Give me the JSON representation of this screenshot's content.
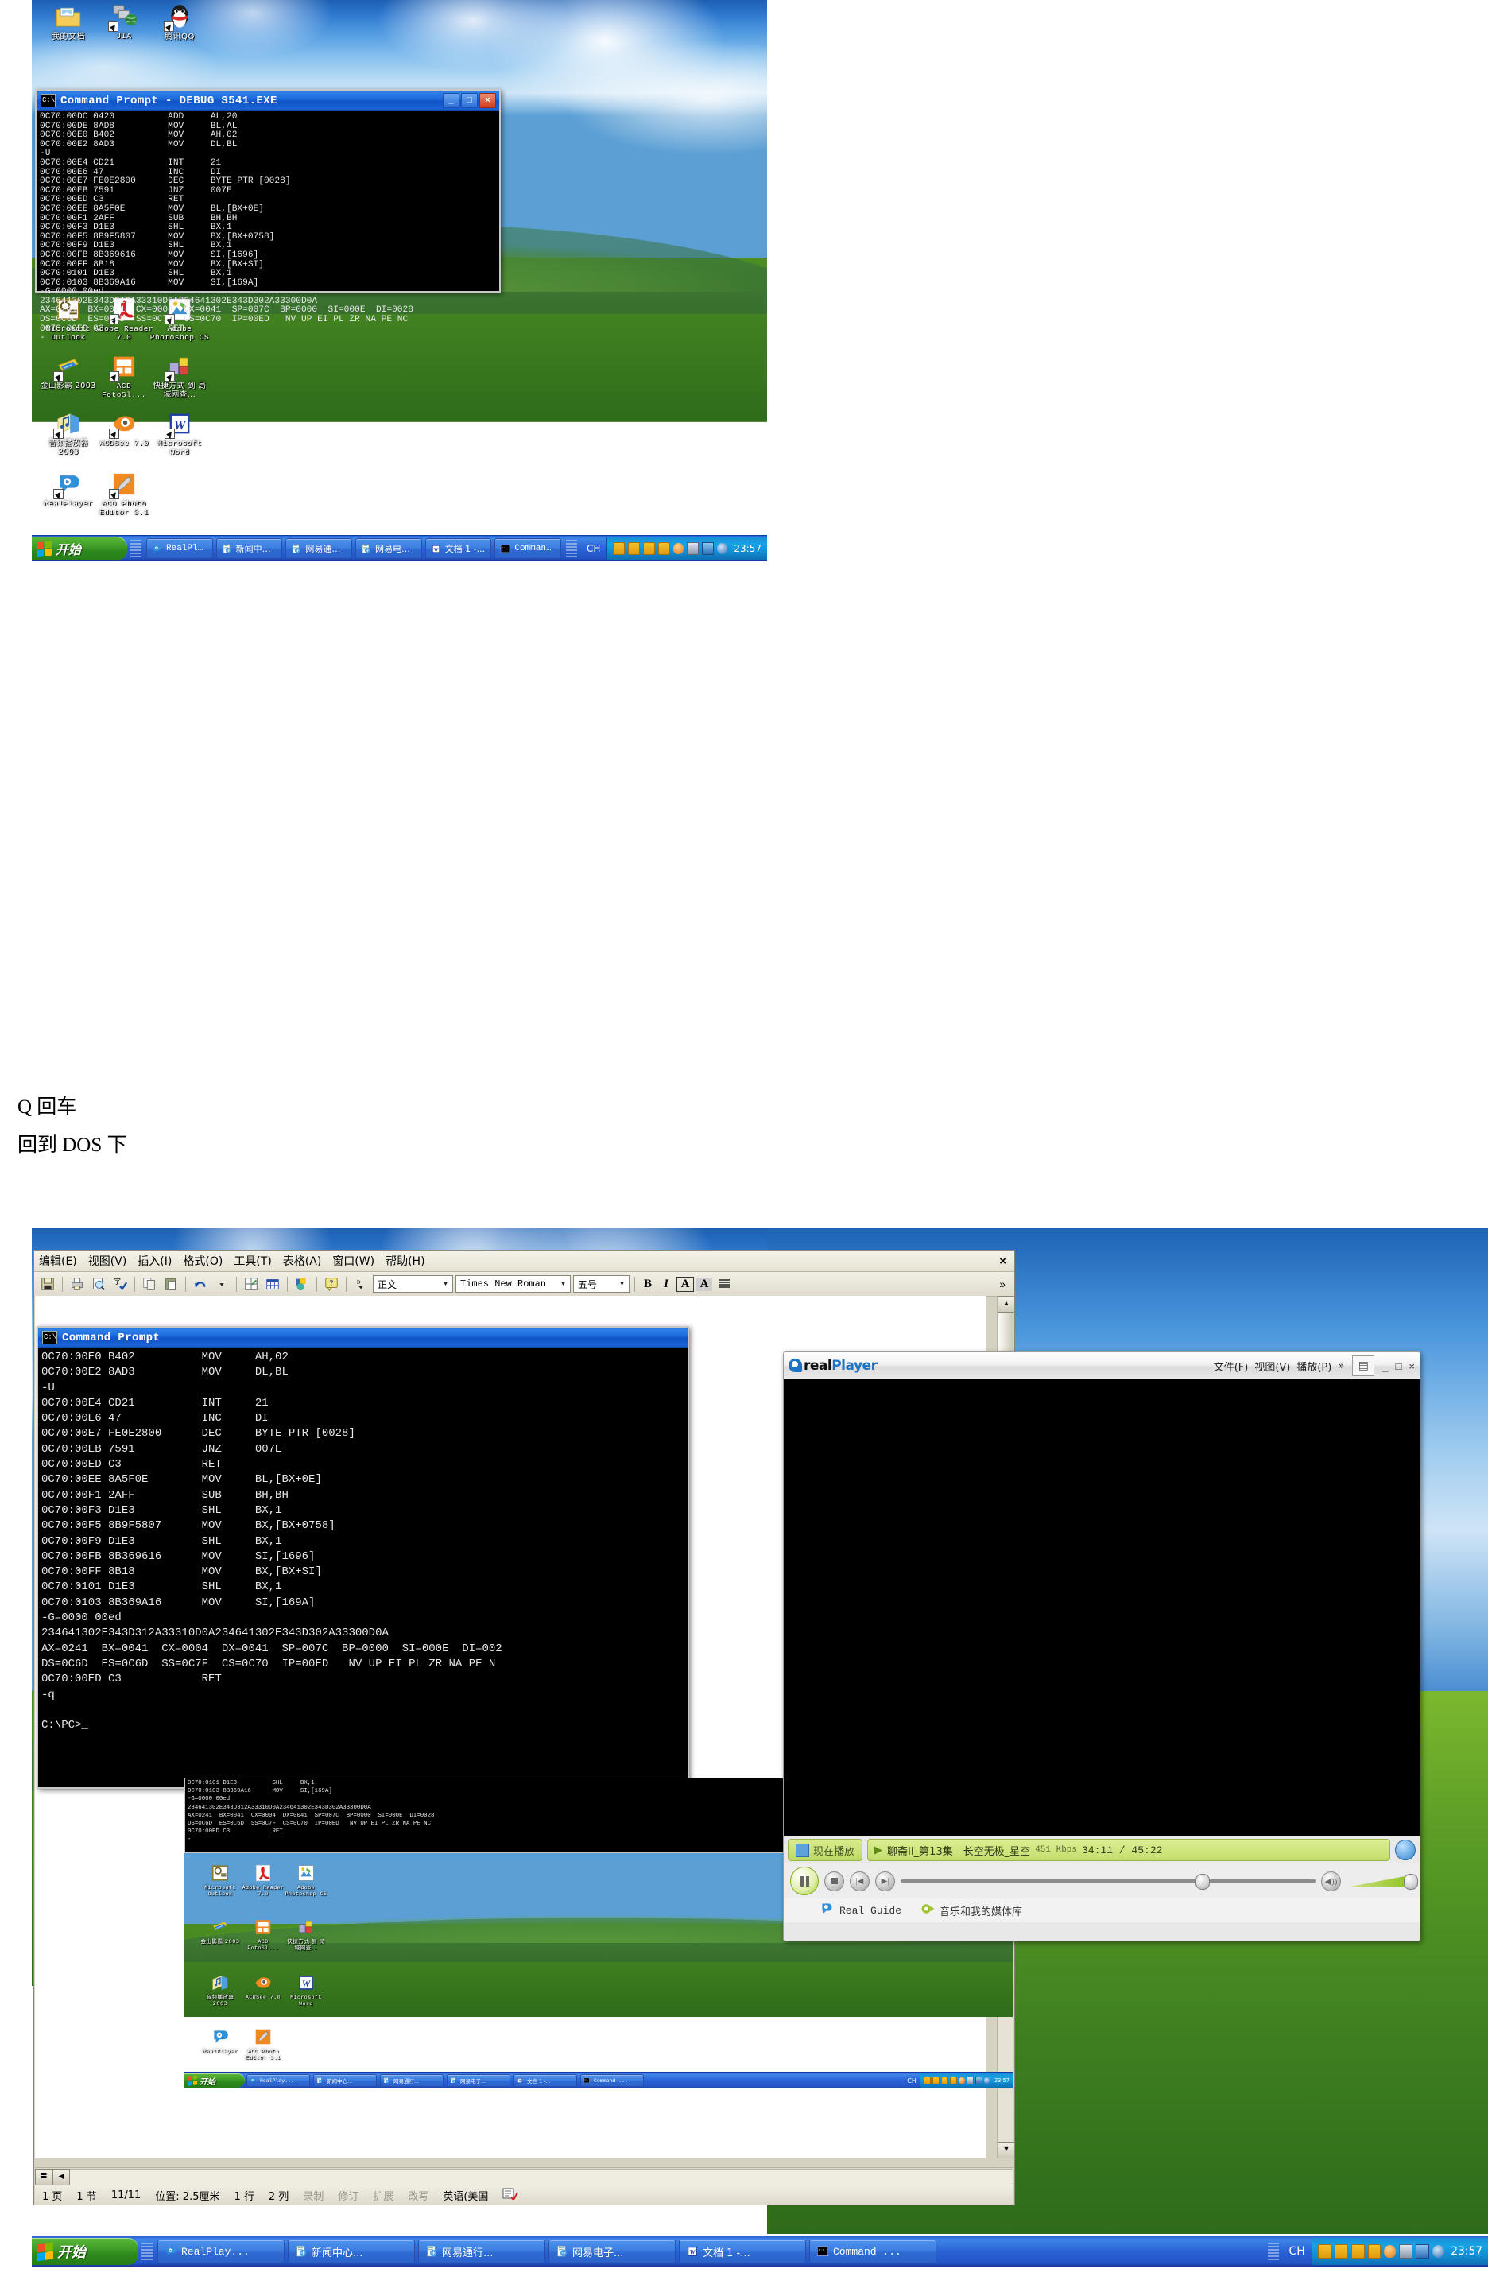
{
  "page": {
    "note_line1": "Q 回车",
    "note_line2": "回到 DOS 下"
  },
  "screenshot1": {
    "console": {
      "title": "Command Prompt - DEBUG S541.EXE",
      "icon": "console-icon",
      "minimize_label": "_",
      "maximize_label": "□",
      "close_label": "×",
      "lines": [
        "0C70:00DC 0420          ADD     AL,20",
        "0C70:00DE 8AD8          MOV     BL,AL",
        "0C70:00E0 B402          MOV     AH,02",
        "0C70:00E2 8AD3          MOV     DL,BL",
        "-U",
        "0C70:00E4 CD21          INT     21",
        "0C70:00E6 47            INC     DI",
        "0C70:00E7 FE0E2800      DEC     BYTE PTR [0028]",
        "0C70:00EB 7591          JNZ     007E",
        "0C70:00ED C3            RET",
        "0C70:00EE 8A5F0E        MOV     BL,[BX+0E]",
        "0C70:00F1 2AFF          SUB     BH,BH",
        "0C70:00F3 D1E3          SHL     BX,1",
        "0C70:00F5 8B9F5807      MOV     BX,[BX+0758]",
        "0C70:00F9 D1E3          SHL     BX,1",
        "0C70:00FB 8B369616      MOV     SI,[1696]",
        "0C70:00FF 8B18          MOV     BX,[BX+SI]",
        "0C70:0101 D1E3          SHL     BX,1",
        "0C70:0103 8B369A16      MOV     SI,[169A]",
        "-G=0000 00ed",
        "234641302E343D312A33310D0A234641302E343D302A33300D0A",
        "AX=0241  BX=0041  CX=0004  DX=0041  SP=007C  BP=0000  SI=000E  DI=0028",
        "DS=0C6D  ES=0C6D  SS=0C7F  CS=0C70  IP=00ED   NV UP EI PL ZR NA PE NC",
        "0C70:00ED C3            RET",
        "-"
      ]
    },
    "desktop_icons_top": [
      {
        "label": "我的文档",
        "icon": "my-documents-icon",
        "shortcut": false
      },
      {
        "label": "JIA",
        "icon": "network-shortcut-icon",
        "shortcut": true
      },
      {
        "label": "腾讯QQ",
        "icon": "tencent-qq-icon",
        "shortcut": true
      }
    ],
    "desktop_icons": [
      {
        "label": "Microsoft\nOutlook",
        "icon": "outlook-icon",
        "shortcut": false
      },
      {
        "label": "Adobe Reader\n7.0",
        "icon": "adobe-reader-icon",
        "shortcut": true
      },
      {
        "label": "Adobe\nPhotoshop CS",
        "icon": "photoshop-icon",
        "shortcut": true
      },
      {
        "label": "金山影霸\n2003",
        "icon": "kingsoft-video-icon",
        "shortcut": true
      },
      {
        "label": "ACD\nFotoSl...",
        "icon": "acd-fotoslate-icon",
        "shortcut": true
      },
      {
        "label": "快捷方式 到\n局域网查...",
        "icon": "lan-shortcut-icon",
        "shortcut": true
      },
      {
        "label": "音频播放器\n2003",
        "icon": "audio-player-icon",
        "shortcut": true
      },
      {
        "label": "ACDSee 7.0",
        "icon": "acdsee-icon",
        "shortcut": true
      },
      {
        "label": "Microsoft\nWord",
        "icon": "word-icon",
        "shortcut": true
      },
      {
        "label": "RealPlayer",
        "icon": "realplayer-icon",
        "shortcut": true
      },
      {
        "label": "ACD Photo\nEditor 3.1",
        "icon": "acd-photo-editor-icon",
        "shortcut": true
      }
    ],
    "taskbar": {
      "start_label": "开始",
      "buttons": [
        {
          "label": "RealPlay...",
          "icon": "realplayer-icon"
        },
        {
          "label": "新闻中心...",
          "icon": "ie-icon"
        },
        {
          "label": "网易通行...",
          "icon": "ie-icon"
        },
        {
          "label": "网易电子...",
          "icon": "ie-icon"
        },
        {
          "label": "文档 1 -...",
          "icon": "word-icon"
        },
        {
          "label": "Command ...",
          "icon": "console-icon"
        }
      ],
      "ime_label": "CH",
      "clock": "23:57"
    }
  },
  "screenshot2": {
    "word": {
      "menus": [
        "编辑(E)",
        "视图(V)",
        "插入(I)",
        "格式(O)",
        "工具(T)",
        "表格(A)",
        "窗口(W)",
        "帮助(H)"
      ],
      "close_label": "×",
      "toolbar_icons": [
        "save-icon",
        "print-icon",
        "print-preview-icon",
        "spellcheck-icon",
        "copy-icon",
        "paste-icon",
        "undo-icon",
        "undo-dropdown-icon",
        "insert-hyperlink-icon",
        "insert-table-icon",
        "drawing-icon",
        "help-icon",
        "more-buttons-icon"
      ],
      "style_value": "正文",
      "font_value": "Times New Roman",
      "size_value": "五号",
      "bold_label": "B",
      "italic_label": "I",
      "border_label": "A",
      "highlight_label": "A",
      "align_icon": "align-justify-icon",
      "more_label": "»",
      "status": {
        "page": "1 页",
        "section": "1 节",
        "pages": "11/11",
        "position": "位置: 2.5厘米",
        "line": "1 行",
        "column": "2 列",
        "rec": "录制",
        "trk": "修订",
        "ext": "扩展",
        "ovr": "改写",
        "language": "英语(美国",
        "spell_icon": "spellcheck-status-icon"
      },
      "view_icon": "outline-view-icon",
      "scroll_left_label": "◀",
      "scroll_right_label": "▶",
      "scroll_up_label": "▲",
      "scroll_down_label": "▼"
    },
    "console": {
      "title": "Command Prompt",
      "icon": "console-icon",
      "lines": [
        "0C70:00E0 B402          MOV     AH,02",
        "0C70:00E2 8AD3          MOV     DL,BL",
        "-U",
        "0C70:00E4 CD21          INT     21",
        "0C70:00E6 47            INC     DI",
        "0C70:00E7 FE0E2800      DEC     BYTE PTR [0028]",
        "0C70:00EB 7591          JNZ     007E",
        "0C70:00ED C3            RET",
        "0C70:00EE 8A5F0E        MOV     BL,[BX+0E]",
        "0C70:00F1 2AFF          SUB     BH,BH",
        "0C70:00F3 D1E3          SHL     BX,1",
        "0C70:00F5 8B9F5807      MOV     BX,[BX+0758]",
        "0C70:00F9 D1E3          SHL     BX,1",
        "0C70:00FB 8B369616      MOV     SI,[1696]",
        "0C70:00FF 8B18          MOV     BX,[BX+SI]",
        "0C70:0101 D1E3          SHL     BX,1",
        "0C70:0103 8B369A16      MOV     SI,[169A]",
        "-G=0000 00ed",
        "234641302E343D312A33310D0A234641302E343D302A33300D0A",
        "AX=0241  BX=0041  CX=0004  DX=0041  SP=007C  BP=0000  SI=000E  DI=002",
        "DS=0C6D  ES=0C6D  SS=0C7F  CS=0C70  IP=00ED   NV UP EI PL ZR NA PE N",
        "0C70:00ED C3            RET",
        "-q",
        "",
        "C:\\PC>_"
      ]
    },
    "embedded_console": {
      "lines": [
        "0C70:0101 D1E3          SHL     BX,1",
        "0C70:0103 8B369A16      MOV     SI,[169A]",
        "-G=0000 00ed",
        "234641302E343D312A33310D0A234641302E343D302A33300D0A",
        "AX=0241  BX=0041  CX=0004  DX=0041  SP=007C  BP=0000  SI=000E  DI=0028",
        "DS=0C6D  ES=0C6D  SS=0C7F  CS=0C70  IP=00ED   NV UP EI PL ZR NA PE NC",
        "0C70:00ED C3            RET",
        "-"
      ]
    },
    "realplayer": {
      "logo_real": "real",
      "logo_player": "Player",
      "menus": [
        "文件(F)",
        "视图(V)",
        "播放(P)",
        "»"
      ],
      "menu_extra_icon": "media-browser-icon",
      "minimize_label": "_",
      "maximize_label": "□",
      "close_label": "×",
      "now_playing_label": "现在播放",
      "now_playing_icon": "now-playing-icon",
      "play_arrow": "▶",
      "clip_title": "聊斋II_第13集 - 长空无极_星空",
      "bitrate": "451 Kbps",
      "time": "34:11 / 45:22",
      "globe_icon": "globe-icon",
      "pause_icon": "pause-icon",
      "stop_icon": "stop-icon",
      "prev_icon": "previous-icon",
      "next_icon": "next-icon",
      "volume_icon": "volume-icon",
      "footer": [
        {
          "label": "Real Guide",
          "icon": "real-guide-icon"
        },
        {
          "label": "音乐和我的媒体库",
          "icon": "media-library-icon"
        }
      ]
    },
    "taskbar": {
      "start_label": "开始",
      "buttons": [
        {
          "label": "RealPlay...",
          "icon": "realplayer-icon"
        },
        {
          "label": "新闻中心...",
          "icon": "ie-icon"
        },
        {
          "label": "网易通行...",
          "icon": "ie-icon"
        },
        {
          "label": "网易电子...",
          "icon": "ie-icon"
        },
        {
          "label": "文档 1 -...",
          "icon": "word-icon"
        },
        {
          "label": "Command ...",
          "icon": "console-icon"
        }
      ],
      "ime_label": "CH",
      "clock": "23:57"
    }
  },
  "colors": {
    "title_blue": "#1e6ddd",
    "taskbar_blue": "#2a62d6",
    "start_green": "#3e9c28",
    "console_bg": "#000000",
    "console_fg": "#e8e8e8",
    "rp_green": "#9cc22a"
  }
}
